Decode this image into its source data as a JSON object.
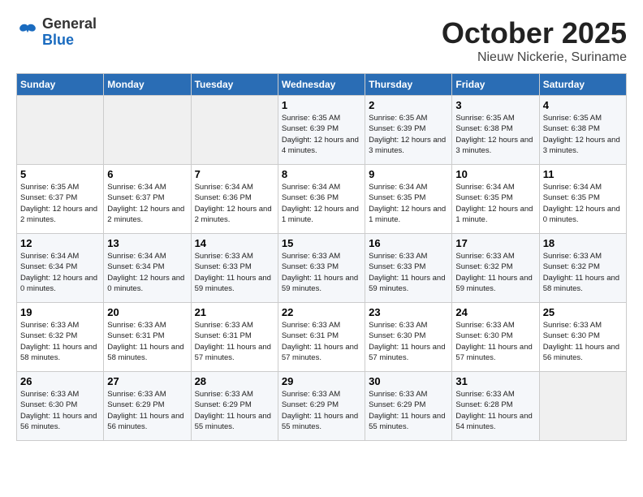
{
  "header": {
    "logo_general": "General",
    "logo_blue": "Blue",
    "month_title": "October 2025",
    "location": "Nieuw Nickerie, Suriname"
  },
  "weekdays": [
    "Sunday",
    "Monday",
    "Tuesday",
    "Wednesday",
    "Thursday",
    "Friday",
    "Saturday"
  ],
  "weeks": [
    [
      {
        "day": "",
        "info": ""
      },
      {
        "day": "",
        "info": ""
      },
      {
        "day": "",
        "info": ""
      },
      {
        "day": "1",
        "info": "Sunrise: 6:35 AM\nSunset: 6:39 PM\nDaylight: 12 hours\nand 4 minutes."
      },
      {
        "day": "2",
        "info": "Sunrise: 6:35 AM\nSunset: 6:39 PM\nDaylight: 12 hours\nand 3 minutes."
      },
      {
        "day": "3",
        "info": "Sunrise: 6:35 AM\nSunset: 6:38 PM\nDaylight: 12 hours\nand 3 minutes."
      },
      {
        "day": "4",
        "info": "Sunrise: 6:35 AM\nSunset: 6:38 PM\nDaylight: 12 hours\nand 3 minutes."
      }
    ],
    [
      {
        "day": "5",
        "info": "Sunrise: 6:35 AM\nSunset: 6:37 PM\nDaylight: 12 hours\nand 2 minutes."
      },
      {
        "day": "6",
        "info": "Sunrise: 6:34 AM\nSunset: 6:37 PM\nDaylight: 12 hours\nand 2 minutes."
      },
      {
        "day": "7",
        "info": "Sunrise: 6:34 AM\nSunset: 6:36 PM\nDaylight: 12 hours\nand 2 minutes."
      },
      {
        "day": "8",
        "info": "Sunrise: 6:34 AM\nSunset: 6:36 PM\nDaylight: 12 hours\nand 1 minute."
      },
      {
        "day": "9",
        "info": "Sunrise: 6:34 AM\nSunset: 6:35 PM\nDaylight: 12 hours\nand 1 minute."
      },
      {
        "day": "10",
        "info": "Sunrise: 6:34 AM\nSunset: 6:35 PM\nDaylight: 12 hours\nand 1 minute."
      },
      {
        "day": "11",
        "info": "Sunrise: 6:34 AM\nSunset: 6:35 PM\nDaylight: 12 hours\nand 0 minutes."
      }
    ],
    [
      {
        "day": "12",
        "info": "Sunrise: 6:34 AM\nSunset: 6:34 PM\nDaylight: 12 hours\nand 0 minutes."
      },
      {
        "day": "13",
        "info": "Sunrise: 6:34 AM\nSunset: 6:34 PM\nDaylight: 12 hours\nand 0 minutes."
      },
      {
        "day": "14",
        "info": "Sunrise: 6:33 AM\nSunset: 6:33 PM\nDaylight: 11 hours\nand 59 minutes."
      },
      {
        "day": "15",
        "info": "Sunrise: 6:33 AM\nSunset: 6:33 PM\nDaylight: 11 hours\nand 59 minutes."
      },
      {
        "day": "16",
        "info": "Sunrise: 6:33 AM\nSunset: 6:33 PM\nDaylight: 11 hours\nand 59 minutes."
      },
      {
        "day": "17",
        "info": "Sunrise: 6:33 AM\nSunset: 6:32 PM\nDaylight: 11 hours\nand 59 minutes."
      },
      {
        "day": "18",
        "info": "Sunrise: 6:33 AM\nSunset: 6:32 PM\nDaylight: 11 hours\nand 58 minutes."
      }
    ],
    [
      {
        "day": "19",
        "info": "Sunrise: 6:33 AM\nSunset: 6:32 PM\nDaylight: 11 hours\nand 58 minutes."
      },
      {
        "day": "20",
        "info": "Sunrise: 6:33 AM\nSunset: 6:31 PM\nDaylight: 11 hours\nand 58 minutes."
      },
      {
        "day": "21",
        "info": "Sunrise: 6:33 AM\nSunset: 6:31 PM\nDaylight: 11 hours\nand 57 minutes."
      },
      {
        "day": "22",
        "info": "Sunrise: 6:33 AM\nSunset: 6:31 PM\nDaylight: 11 hours\nand 57 minutes."
      },
      {
        "day": "23",
        "info": "Sunrise: 6:33 AM\nSunset: 6:30 PM\nDaylight: 11 hours\nand 57 minutes."
      },
      {
        "day": "24",
        "info": "Sunrise: 6:33 AM\nSunset: 6:30 PM\nDaylight: 11 hours\nand 57 minutes."
      },
      {
        "day": "25",
        "info": "Sunrise: 6:33 AM\nSunset: 6:30 PM\nDaylight: 11 hours\nand 56 minutes."
      }
    ],
    [
      {
        "day": "26",
        "info": "Sunrise: 6:33 AM\nSunset: 6:30 PM\nDaylight: 11 hours\nand 56 minutes."
      },
      {
        "day": "27",
        "info": "Sunrise: 6:33 AM\nSunset: 6:29 PM\nDaylight: 11 hours\nand 56 minutes."
      },
      {
        "day": "28",
        "info": "Sunrise: 6:33 AM\nSunset: 6:29 PM\nDaylight: 11 hours\nand 55 minutes."
      },
      {
        "day": "29",
        "info": "Sunrise: 6:33 AM\nSunset: 6:29 PM\nDaylight: 11 hours\nand 55 minutes."
      },
      {
        "day": "30",
        "info": "Sunrise: 6:33 AM\nSunset: 6:29 PM\nDaylight: 11 hours\nand 55 minutes."
      },
      {
        "day": "31",
        "info": "Sunrise: 6:33 AM\nSunset: 6:28 PM\nDaylight: 11 hours\nand 54 minutes."
      },
      {
        "day": "",
        "info": ""
      }
    ]
  ]
}
